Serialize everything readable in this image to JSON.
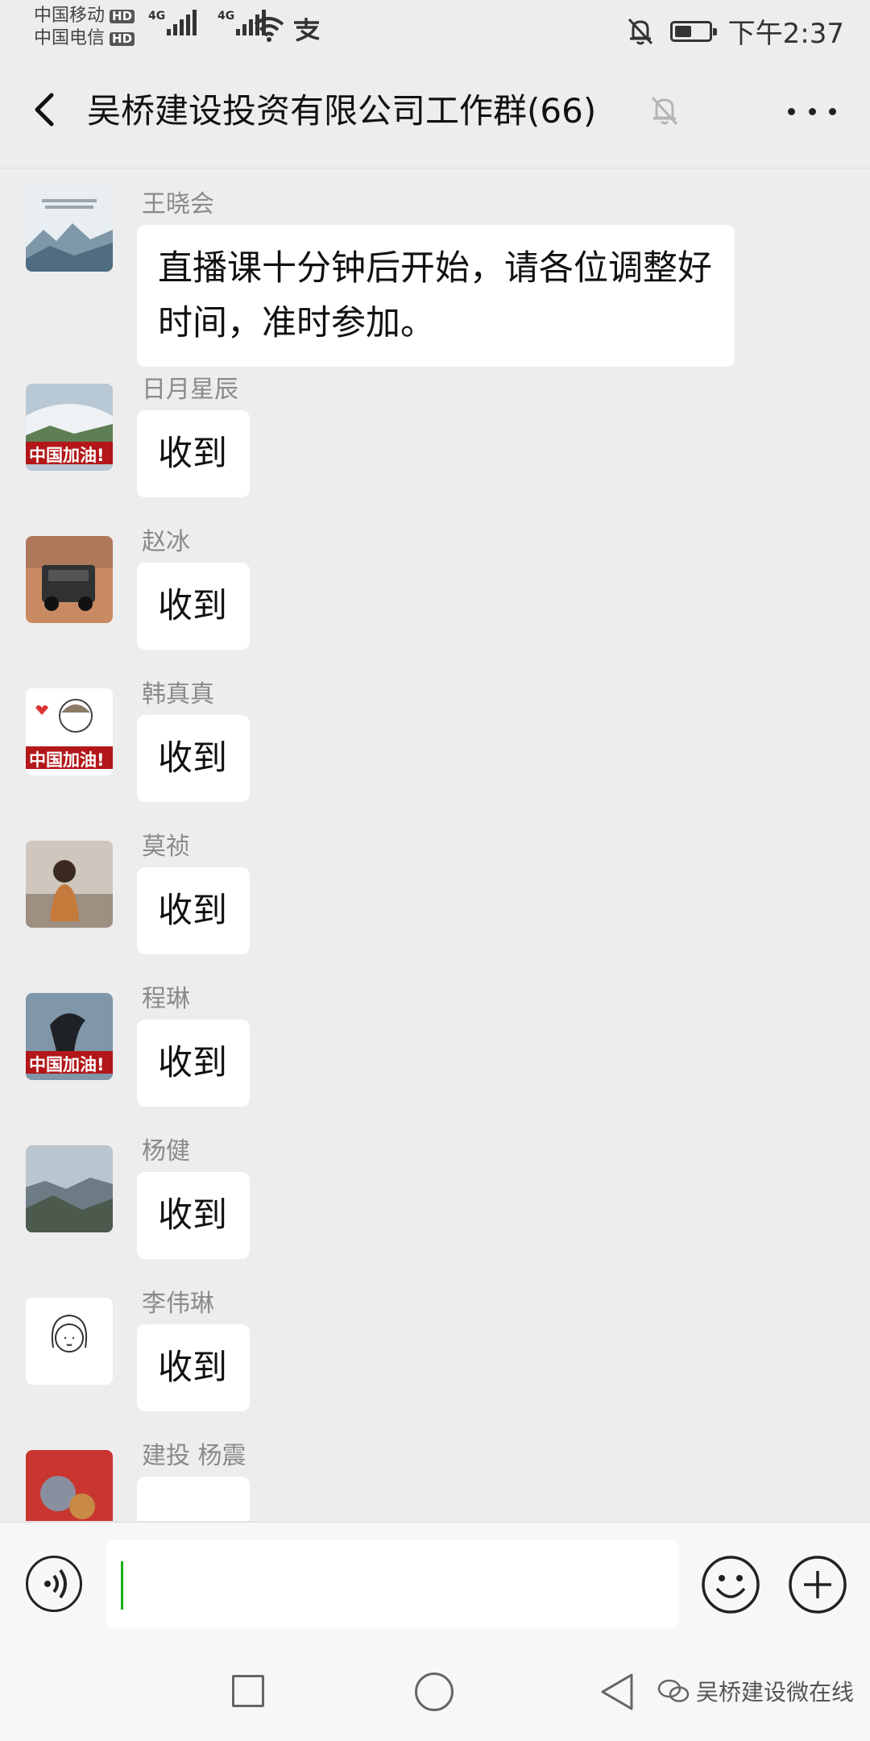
{
  "status_bar": {
    "carrier_1": "中国移动",
    "carrier_2": "中国电信",
    "hd_badge": "HD",
    "network_1": "4G",
    "network_2": "4G",
    "time": "下午2:37",
    "battery_level": 0.5,
    "icons": [
      "signal-icon",
      "wifi-icon",
      "alipay-icon",
      "notifications-off-icon",
      "battery-icon"
    ]
  },
  "header": {
    "title": "吴桥建设投资有限公司工作群(66)",
    "back_icon": "chevron-left-icon",
    "mute_icon": "bell-off-icon",
    "more_icon": "more-dots-icon"
  },
  "messages": [
    {
      "sender": "王晓会",
      "text": "直播课十分钟后开始，请各位调整好时间，准时参加。"
    },
    {
      "sender": "日月星辰",
      "text": "收到",
      "avatar_text": "中国加油!"
    },
    {
      "sender": "赵冰",
      "text": "收到"
    },
    {
      "sender": "韩真真",
      "text": "收到",
      "avatar_text": "中国加油!"
    },
    {
      "sender": "莫祯",
      "text": "收到"
    },
    {
      "sender": "程琳",
      "text": "收到",
      "avatar_text": "中国加油!"
    },
    {
      "sender": "杨健",
      "text": "收到"
    },
    {
      "sender": "李伟琳",
      "text": "收到"
    },
    {
      "sender": "建投 杨震",
      "text": ""
    }
  ],
  "input_bar": {
    "value": "",
    "voice_icon": "voice-icon",
    "emoji_icon": "emoji-icon",
    "plus_icon": "plus-icon"
  },
  "nav_bar": {
    "icons": [
      "recent-apps-icon",
      "home-icon",
      "back-icon"
    ],
    "watermark": "吴桥建设微在线"
  },
  "colors": {
    "background": "#ededed",
    "bubble": "#ffffff",
    "caret": "#1aad19",
    "avatar_banner": "#b3171a"
  }
}
